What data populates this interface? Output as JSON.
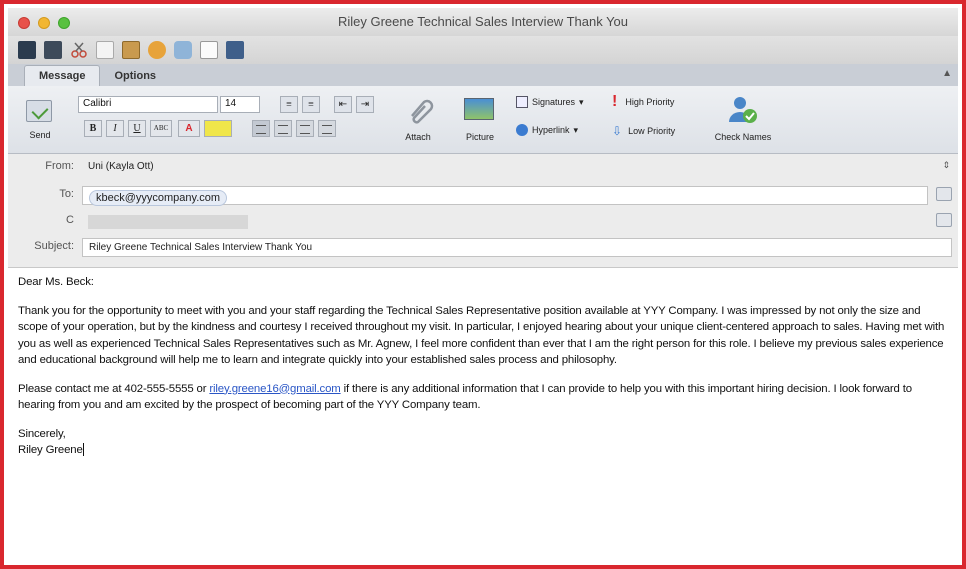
{
  "window": {
    "title": "Riley Greene Technical Sales Interview Thank You"
  },
  "ribbon_tabs": [
    {
      "label": "Message"
    },
    {
      "label": "Options"
    }
  ],
  "ribbon": {
    "send_label": "Send",
    "font_name": "Calibri",
    "font_size": "14",
    "attach_label": "Attach",
    "picture_label": "Picture",
    "signatures_label": "Signatures",
    "hyperlink_label": "Hyperlink",
    "high_priority_label": "High Priority",
    "low_priority_label": "Low Priority",
    "check_names_label": "Check Names",
    "bold": "B",
    "italic": "I",
    "underline": "U",
    "strike": "ABC",
    "font_color": "A"
  },
  "header": {
    "from_label": "From:",
    "from_value": "Uni (Kayla Ott)",
    "to_label": "To:",
    "to_value": "kbeck@yyycompany.com",
    "cc_label": "C",
    "subject_label": "Subject:",
    "subject_value": "Riley Greene Technical Sales Interview Thank You"
  },
  "message": {
    "greeting": "Dear Ms. Beck:",
    "paragraph1": "Thank you for the opportunity to meet with you and your staff regarding the Technical Sales Representative position available at YYY Company. I was impressed by not only the size and scope of your operation, but by the kindness and courtesy I received throughout my visit. In particular, I enjoyed hearing about your unique client-centered approach to sales. Having met with you as well as experienced Technical Sales Representatives such as Mr. Agnew, I feel more confident than ever that I am the right person for this role. I believe my previous sales experience and educational background will help me to learn and integrate quickly into your established sales process and philosophy.",
    "paragraph2_before": "Please contact me at 402-555-5555 or ",
    "email_link": "riley.greene16@gmail.com",
    "paragraph2_after": " if there is any additional information that I can provide to help you with this important hiring decision. I look forward to hearing from you and am excited by the prospect of becoming part of the YYY Company team.",
    "closing": "Sincerely,",
    "signature": "Riley Greene"
  },
  "colors": {
    "frame_border": "#d9272e",
    "link": "#2a56c6"
  }
}
